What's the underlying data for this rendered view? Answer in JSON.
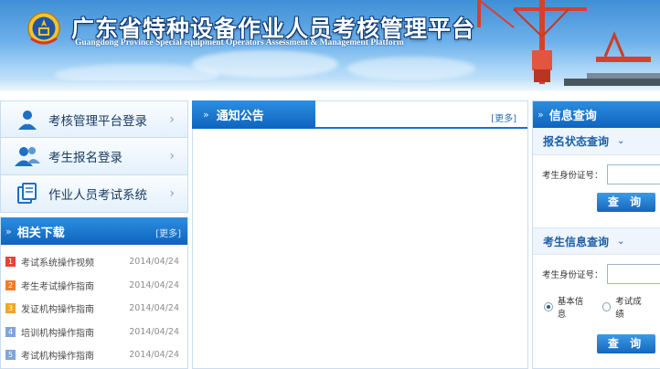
{
  "header": {
    "title_cn": "广东省特种设备作业人员考核管理平台",
    "title_en": "Guangdong Province Special equipment Operators Assessment & Management Platform"
  },
  "sidebar": {
    "items": [
      {
        "label": "考核管理平台登录",
        "icon": "person-icon"
      },
      {
        "label": "考生报名登录",
        "icon": "users-icon"
      },
      {
        "label": "作业人员考试系统",
        "icon": "documents-icon"
      }
    ]
  },
  "downloads": {
    "title": "相关下载",
    "more": "[更多]",
    "items": [
      {
        "num": "1",
        "color": "#e0463d",
        "title": "考试系统操作视频",
        "date": "2014/04/24"
      },
      {
        "num": "2",
        "color": "#f07c2b",
        "title": "考生考试操作指南",
        "date": "2014/04/24"
      },
      {
        "num": "3",
        "color": "#f3a524",
        "title": "发证机构操作指南",
        "date": "2014/04/24"
      },
      {
        "num": "4",
        "color": "#7ea6d8",
        "title": "培训机构操作指南",
        "date": "2014/04/24"
      },
      {
        "num": "5",
        "color": "#7ea6d8",
        "title": "考试机构操作指南",
        "date": "2014/04/24"
      }
    ]
  },
  "notice": {
    "title": "通知公告",
    "more": "[更多]"
  },
  "info": {
    "title": "信息查询",
    "status": {
      "title": "报名状态查询",
      "id_label": "考生身份证号：",
      "button": "查 询"
    },
    "examinee": {
      "title": "考生信息查询",
      "id_label": "考生身份证号：",
      "options": [
        "基本信息",
        "考试成绩"
      ],
      "selected": "基本信息",
      "button": "查 询"
    }
  },
  "colors": {
    "primary_blue": "#0e64bd",
    "panel_border": "#c9ddf0",
    "nav_text": "#1a3c64"
  }
}
